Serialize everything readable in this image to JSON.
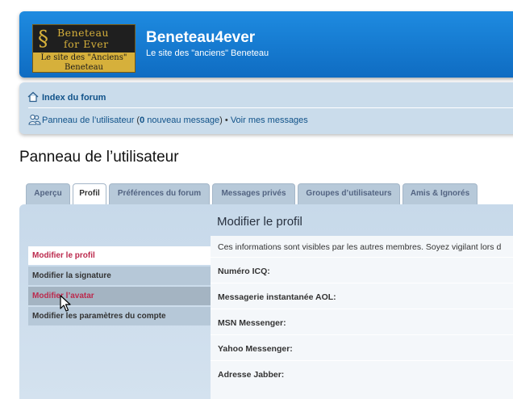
{
  "header": {
    "logo": {
      "line1": "Beneteau",
      "line2": "for Ever",
      "line3": "Le site des \"Anciens\"",
      "line4": "Beneteau",
      "glyph": "§"
    },
    "site_title": "Beneteau4ever",
    "site_description": "Le site des \"anciens\" Beneteau"
  },
  "navbar": {
    "home_label": "Index du forum",
    "home_icon": "home-icon",
    "user_icon": "user-icon",
    "panel_link": "Panneau de l’utilisateur",
    "open_paren": " (",
    "new_count": "0",
    "new_label": " nouveau message",
    "close_sep": ") • ",
    "my_messages": "Voir mes messages"
  },
  "page_title": "Panneau de l’utilisateur",
  "tabs": [
    {
      "label": "Aperçu"
    },
    {
      "label": "Profil"
    },
    {
      "label": "Préférences du forum"
    },
    {
      "label": "Messages privés"
    },
    {
      "label": "Groupes d’utilisateurs"
    },
    {
      "label": "Amis & Ignorés"
    }
  ],
  "active_tab": "Profil",
  "sidebar": {
    "items": [
      {
        "label": "Modifier le profil"
      },
      {
        "label": "Modifier la signature"
      },
      {
        "label": "Modifier l’avatar"
      },
      {
        "label": "Modifier les paramètres du compte"
      }
    ]
  },
  "content": {
    "heading": "Modifier le profil",
    "intro": "Ces informations sont visibles par les autres membres. Soyez vigilant lors d",
    "fields": [
      {
        "label": "Numéro ICQ:"
      },
      {
        "label": "Messagerie instantanée AOL:"
      },
      {
        "label": "MSN Messenger:"
      },
      {
        "label": "Yahoo Messenger:"
      },
      {
        "label": "Adresse Jabber:"
      }
    ]
  },
  "colors": {
    "header_blue": "#1278d2",
    "link_blue": "#105289",
    "active_red": "#bc2a4d",
    "panel_bg": "#cadceb"
  }
}
